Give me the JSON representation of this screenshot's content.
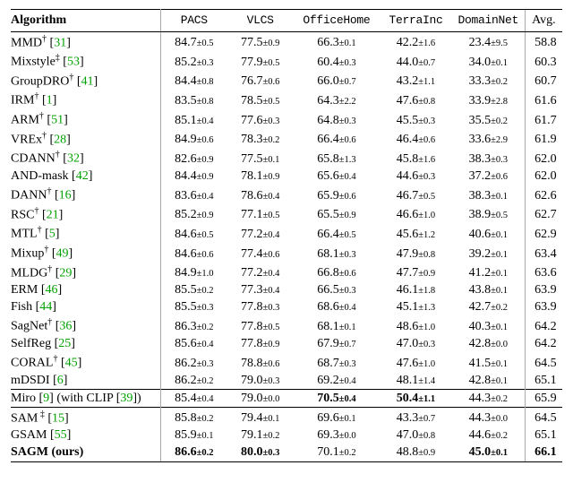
{
  "chart_data": {
    "type": "table",
    "title": "",
    "columns": [
      "Algorithm",
      "PACS",
      "VLCS",
      "OfficeHome",
      "TerraInc",
      "DomainNet",
      "Avg."
    ],
    "groups": [
      {
        "rows": [
          {
            "name": "MMD",
            "sup": "†",
            "ref": "31",
            "PACS": {
              "v": "84.7",
              "e": "0.5"
            },
            "VLCS": {
              "v": "77.5",
              "e": "0.9"
            },
            "OfficeHome": {
              "v": "66.3",
              "e": "0.1"
            },
            "TerraInc": {
              "v": "42.2",
              "e": "1.6"
            },
            "DomainNet": {
              "v": "23.4",
              "e": "9.5"
            },
            "Avg": "58.8"
          },
          {
            "name": "Mixstyle",
            "sup": "‡",
            "ref": "53",
            "PACS": {
              "v": "85.2",
              "e": "0.3"
            },
            "VLCS": {
              "v": "77.9",
              "e": "0.5"
            },
            "OfficeHome": {
              "v": "60.4",
              "e": "0.3"
            },
            "TerraInc": {
              "v": "44.0",
              "e": "0.7"
            },
            "DomainNet": {
              "v": "34.0",
              "e": "0.1"
            },
            "Avg": "60.3"
          },
          {
            "name": "GroupDRO",
            "sup": "†",
            "ref": "41",
            "PACS": {
              "v": "84.4",
              "e": "0.8"
            },
            "VLCS": {
              "v": "76.7",
              "e": "0.6"
            },
            "OfficeHome": {
              "v": "66.0",
              "e": "0.7"
            },
            "TerraInc": {
              "v": "43.2",
              "e": "1.1"
            },
            "DomainNet": {
              "v": "33.3",
              "e": "0.2"
            },
            "Avg": "60.7"
          },
          {
            "name": "IRM",
            "sup": "†",
            "ref": "1",
            "PACS": {
              "v": "83.5",
              "e": "0.8"
            },
            "VLCS": {
              "v": "78.5",
              "e": "0.5"
            },
            "OfficeHome": {
              "v": "64.3",
              "e": "2.2"
            },
            "TerraInc": {
              "v": "47.6",
              "e": "0.8"
            },
            "DomainNet": {
              "v": "33.9",
              "e": "2.8"
            },
            "Avg": "61.6"
          },
          {
            "name": "ARM",
            "sup": "†",
            "ref": "51",
            "PACS": {
              "v": "85.1",
              "e": "0.4"
            },
            "VLCS": {
              "v": "77.6",
              "e": "0.3"
            },
            "OfficeHome": {
              "v": "64.8",
              "e": "0.3"
            },
            "TerraInc": {
              "v": "45.5",
              "e": "0.3"
            },
            "DomainNet": {
              "v": "35.5",
              "e": "0.2"
            },
            "Avg": "61.7"
          },
          {
            "name": "VREx",
            "sup": "†",
            "ref": "28",
            "PACS": {
              "v": "84.9",
              "e": "0.6"
            },
            "VLCS": {
              "v": "78.3",
              "e": "0.2"
            },
            "OfficeHome": {
              "v": "66.4",
              "e": "0.6"
            },
            "TerraInc": {
              "v": "46.4",
              "e": "0.6"
            },
            "DomainNet": {
              "v": "33.6",
              "e": "2.9"
            },
            "Avg": "61.9"
          },
          {
            "name": "CDANN",
            "sup": "†",
            "ref": "32",
            "PACS": {
              "v": "82.6",
              "e": "0.9"
            },
            "VLCS": {
              "v": "77.5",
              "e": "0.1"
            },
            "OfficeHome": {
              "v": "65.8",
              "e": "1.3"
            },
            "TerraInc": {
              "v": "45.8",
              "e": "1.6"
            },
            "DomainNet": {
              "v": "38.3",
              "e": "0.3"
            },
            "Avg": "62.0"
          },
          {
            "name": "AND-mask",
            "sup": "",
            "ref": "42",
            "PACS": {
              "v": "84.4",
              "e": "0.9"
            },
            "VLCS": {
              "v": "78.1",
              "e": "0.9"
            },
            "OfficeHome": {
              "v": "65.6",
              "e": "0.4"
            },
            "TerraInc": {
              "v": "44.6",
              "e": "0.3"
            },
            "DomainNet": {
              "v": "37.2",
              "e": "0.6"
            },
            "Avg": "62.0"
          },
          {
            "name": "DANN",
            "sup": "†",
            "ref": "16",
            "PACS": {
              "v": "83.6",
              "e": "0.4"
            },
            "VLCS": {
              "v": "78.6",
              "e": "0.4"
            },
            "OfficeHome": {
              "v": "65.9",
              "e": "0.6"
            },
            "TerraInc": {
              "v": "46.7",
              "e": "0.5"
            },
            "DomainNet": {
              "v": "38.3",
              "e": "0.1"
            },
            "Avg": "62.6"
          },
          {
            "name": "RSC",
            "sup": "†",
            "ref": "21",
            "PACS": {
              "v": "85.2",
              "e": "0.9"
            },
            "VLCS": {
              "v": "77.1",
              "e": "0.5"
            },
            "OfficeHome": {
              "v": "65.5",
              "e": "0.9"
            },
            "TerraInc": {
              "v": "46.6",
              "e": "1.0"
            },
            "DomainNet": {
              "v": "38.9",
              "e": "0.5"
            },
            "Avg": "62.7"
          },
          {
            "name": "MTL",
            "sup": "†",
            "ref": "5",
            "PACS": {
              "v": "84.6",
              "e": "0.5"
            },
            "VLCS": {
              "v": "77.2",
              "e": "0.4"
            },
            "OfficeHome": {
              "v": "66.4",
              "e": "0.5"
            },
            "TerraInc": {
              "v": "45.6",
              "e": "1.2"
            },
            "DomainNet": {
              "v": "40.6",
              "e": "0.1"
            },
            "Avg": "62.9"
          },
          {
            "name": "Mixup",
            "sup": "†",
            "ref": "49",
            "PACS": {
              "v": "84.6",
              "e": "0.6"
            },
            "VLCS": {
              "v": "77.4",
              "e": "0.6"
            },
            "OfficeHome": {
              "v": "68.1",
              "e": "0.3"
            },
            "TerraInc": {
              "v": "47.9",
              "e": "0.8"
            },
            "DomainNet": {
              "v": "39.2",
              "e": "0.1"
            },
            "Avg": "63.4"
          },
          {
            "name": "MLDG",
            "sup": "†",
            "ref": "29",
            "PACS": {
              "v": "84.9",
              "e": "1.0"
            },
            "VLCS": {
              "v": "77.2",
              "e": "0.4"
            },
            "OfficeHome": {
              "v": "66.8",
              "e": "0.6"
            },
            "TerraInc": {
              "v": "47.7",
              "e": "0.9"
            },
            "DomainNet": {
              "v": "41.2",
              "e": "0.1"
            },
            "Avg": "63.6"
          },
          {
            "name": "ERM",
            "sup": "",
            "ref": "46",
            "PACS": {
              "v": "85.5",
              "e": "0.2"
            },
            "VLCS": {
              "v": "77.3",
              "e": "0.4"
            },
            "OfficeHome": {
              "v": "66.5",
              "e": "0.3"
            },
            "TerraInc": {
              "v": "46.1",
              "e": "1.8"
            },
            "DomainNet": {
              "v": "43.8",
              "e": "0.1"
            },
            "Avg": "63.9"
          },
          {
            "name": "Fish",
            "sup": "",
            "ref": "44",
            "PACS": {
              "v": "85.5",
              "e": "0.3"
            },
            "VLCS": {
              "v": "77.8",
              "e": "0.3"
            },
            "OfficeHome": {
              "v": "68.6",
              "e": "0.4"
            },
            "TerraInc": {
              "v": "45.1",
              "e": "1.3"
            },
            "DomainNet": {
              "v": "42.7",
              "e": "0.2"
            },
            "Avg": "63.9"
          },
          {
            "name": "SagNet",
            "sup": "†",
            "ref": "36",
            "PACS": {
              "v": "86.3",
              "e": "0.2"
            },
            "VLCS": {
              "v": "77.8",
              "e": "0.5"
            },
            "OfficeHome": {
              "v": "68.1",
              "e": "0.1"
            },
            "TerraInc": {
              "v": "48.6",
              "e": "1.0"
            },
            "DomainNet": {
              "v": "40.3",
              "e": "0.1"
            },
            "Avg": "64.2"
          },
          {
            "name": "SelfReg",
            "sup": "",
            "ref": "25",
            "PACS": {
              "v": "85.6",
              "e": "0.4"
            },
            "VLCS": {
              "v": "77.8",
              "e": "0.9"
            },
            "OfficeHome": {
              "v": "67.9",
              "e": "0.7"
            },
            "TerraInc": {
              "v": "47.0",
              "e": "0.3"
            },
            "DomainNet": {
              "v": "42.8",
              "e": "0.0"
            },
            "Avg": "64.2"
          },
          {
            "name": "CORAL",
            "sup": "†",
            "ref": "45",
            "PACS": {
              "v": "86.2",
              "e": "0.3"
            },
            "VLCS": {
              "v": "78.8",
              "e": "0.6"
            },
            "OfficeHome": {
              "v": "68.7",
              "e": "0.3"
            },
            "TerraInc": {
              "v": "47.6",
              "e": "1.0"
            },
            "DomainNet": {
              "v": "41.5",
              "e": "0.1"
            },
            "Avg": "64.5"
          },
          {
            "name": "mDSDI",
            "sup": "",
            "ref": "6",
            "PACS": {
              "v": "86.2",
              "e": "0.2"
            },
            "VLCS": {
              "v": "79.0",
              "e": "0.3"
            },
            "OfficeHome": {
              "v": "69.2",
              "e": "0.4"
            },
            "TerraInc": {
              "v": "48.1",
              "e": "1.4"
            },
            "DomainNet": {
              "v": "42.8",
              "e": "0.1"
            },
            "Avg": "65.1"
          }
        ]
      },
      {
        "rows": [
          {
            "name": "Miro",
            "sup": "",
            "ref": "9",
            "suffix_text": " (with CLIP ",
            "suffix_ref": "39",
            "suffix_close": ")",
            "PACS": {
              "v": "85.4",
              "e": "0.4"
            },
            "VLCS": {
              "v": "79.0",
              "e": "0.0"
            },
            "OfficeHome": {
              "v": "70.5",
              "e": "0.4",
              "bold": true
            },
            "TerraInc": {
              "v": "50.4",
              "e": "1.1",
              "bold": true
            },
            "DomainNet": {
              "v": "44.3",
              "e": "0.2"
            },
            "Avg": "65.9"
          }
        ]
      },
      {
        "rows": [
          {
            "name": "SAM",
            "sup": " ‡",
            "ref": "15",
            "PACS": {
              "v": "85.8",
              "e": "0.2"
            },
            "VLCS": {
              "v": "79.4",
              "e": "0.1"
            },
            "OfficeHome": {
              "v": "69.6",
              "e": "0.1"
            },
            "TerraInc": {
              "v": "43.3",
              "e": "0.7"
            },
            "DomainNet": {
              "v": "44.3",
              "e": "0.0"
            },
            "Avg": "64.5"
          },
          {
            "name": "GSAM",
            "sup": "",
            "ref": "55",
            "PACS": {
              "v": "85.9",
              "e": "0.1"
            },
            "VLCS": {
              "v": "79.1",
              "e": "0.2"
            },
            "OfficeHome": {
              "v": "69.3",
              "e": "0.0"
            },
            "TerraInc": {
              "v": "47.0",
              "e": "0.8"
            },
            "DomainNet": {
              "v": "44.6",
              "e": "0.2"
            },
            "Avg": "65.1"
          },
          {
            "name": "SAGM (ours)",
            "sup": "",
            "bold": true,
            "PACS": {
              "v": "86.6",
              "e": "0.2",
              "bold": true
            },
            "VLCS": {
              "v": "80.0",
              "e": "0.3",
              "bold": true
            },
            "OfficeHome": {
              "v": "70.1",
              "e": "0.2"
            },
            "TerraInc": {
              "v": "48.8",
              "e": "0.9"
            },
            "DomainNet": {
              "v": "45.0",
              "e": "0.1",
              "bold": true
            },
            "Avg": "66.1",
            "avg_bold": true
          }
        ]
      }
    ]
  },
  "header": {
    "alg": "Algorithm",
    "c1": "PACS",
    "c2": "VLCS",
    "c3": "OfficeHome",
    "c4": "TerraInc",
    "c5": "DomainNet",
    "avg": "Avg."
  }
}
